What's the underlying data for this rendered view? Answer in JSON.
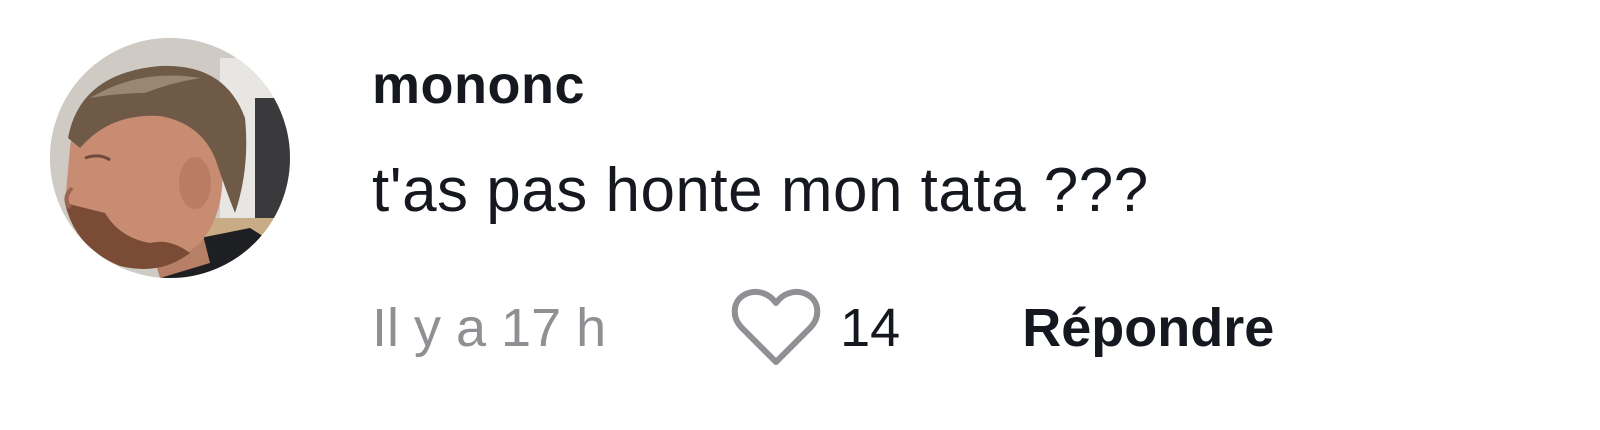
{
  "comment": {
    "username": "mononc",
    "text": "t'as pas honte mon tata ???",
    "timestamp": "Il y a 17 h",
    "like_count": "14",
    "reply_label": "Répondre",
    "liked": false
  },
  "icons": {
    "like": "heart-outline-icon",
    "avatar": "user-avatar"
  },
  "colors": {
    "text_primary": "#16181f",
    "text_secondary": "#8f9094",
    "heart_outline": "#8f9094",
    "background": "#ffffff"
  }
}
